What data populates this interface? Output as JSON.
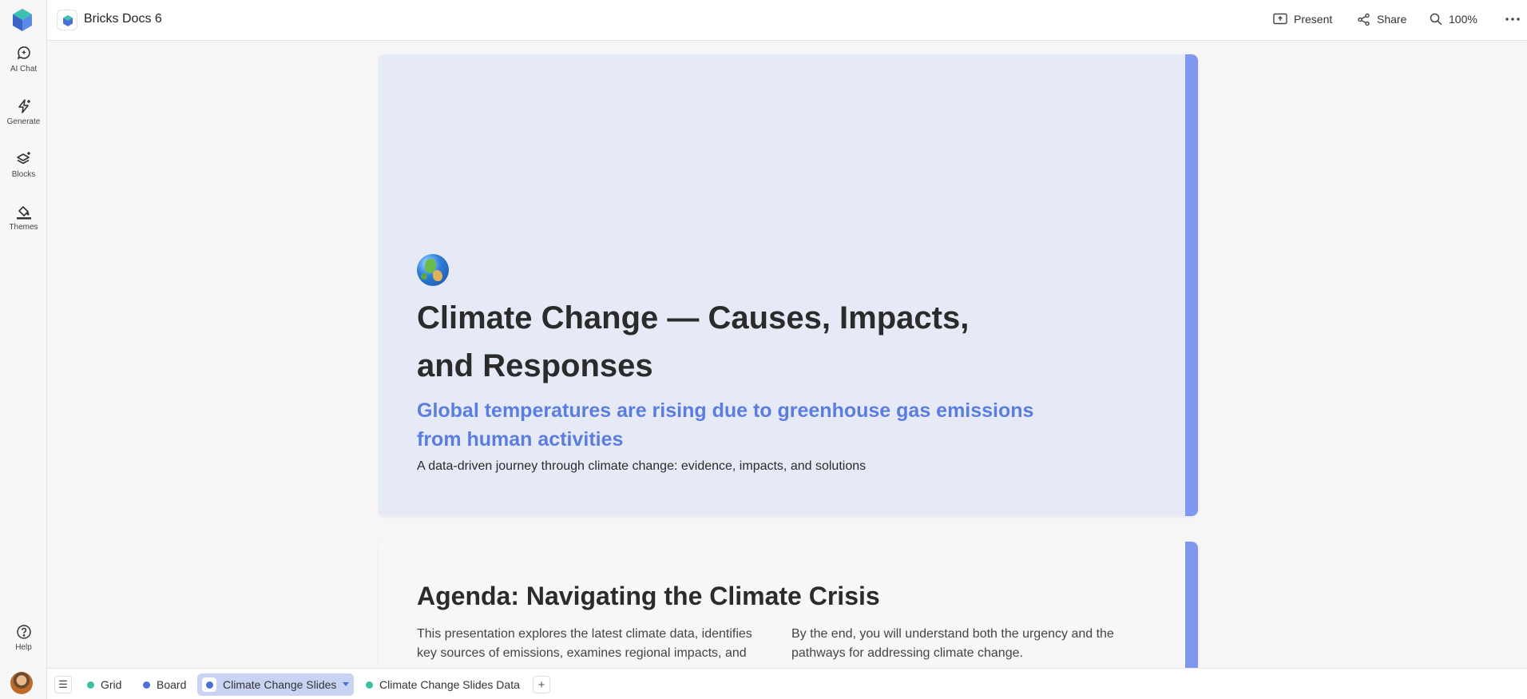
{
  "app": {
    "doc_title": "Bricks Docs 6"
  },
  "sidebar": {
    "items": [
      {
        "label": "AI Chat",
        "icon": "chat-sparkle-icon"
      },
      {
        "label": "Generate",
        "icon": "sparkle-bolt-icon"
      },
      {
        "label": "Blocks",
        "icon": "layers-plus-icon"
      },
      {
        "label": "Themes",
        "icon": "paint-bucket-icon"
      }
    ],
    "help_label": "Help"
  },
  "toolbar": {
    "present_label": "Present",
    "share_label": "Share",
    "zoom_label": "100%"
  },
  "slides": [
    {
      "emoji": "globe-icon",
      "title": "Climate Change — Causes, Impacts, and Responses",
      "subtitle": "Global temperatures are rising due to greenhouse gas emissions from human activities",
      "description": "A data-driven journey through climate change: evidence, impacts, and solutions"
    },
    {
      "title": "Agenda: Navigating the Climate Crisis",
      "col1": "This presentation explores the latest climate data, identifies key sources of emissions, examines regional impacts, and",
      "col2": "By the end, you will understand both the urgency and the pathways for addressing climate change."
    }
  ],
  "tabs": [
    {
      "label": "Grid",
      "dot_color": "#3bbfa4"
    },
    {
      "label": "Board",
      "dot_color": "#4a6fd8"
    },
    {
      "label": "Climate Change Slides",
      "dot_color": "#4a6fd8",
      "active": true
    },
    {
      "label": "Climate Change Slides Data",
      "dot_color": "#3bbfa4"
    }
  ],
  "colors": {
    "accent": "#7f97ef",
    "subtitle": "#5b7de0",
    "slide_bg": "#e6eaf6"
  }
}
